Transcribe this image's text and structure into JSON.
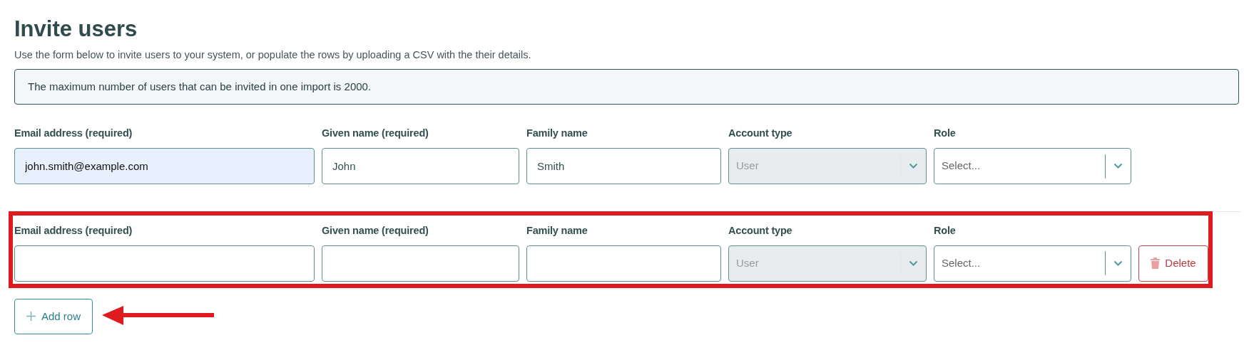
{
  "title": "Invite users",
  "intro": "Use the form below to invite users to your system, or populate the rows by uploading a CSV with the their details.",
  "notice": "The maximum number of users that can be invited in one import is 2000.",
  "rows": [
    {
      "annotated": false,
      "fields": [
        {
          "kind": "text",
          "label": "Email address (required)",
          "value": "john.smith@example.com",
          "autofilled": true
        },
        {
          "kind": "text",
          "label": "Given name (required)",
          "value": "John",
          "autofilled": false
        },
        {
          "kind": "text",
          "label": "Family name",
          "value": "Smith",
          "autofilled": false
        },
        {
          "kind": "select",
          "label": "Account type",
          "value": "User",
          "disabled": true
        },
        {
          "kind": "select",
          "label": "Role",
          "placeholder": "Select...",
          "disabled": false
        }
      ]
    },
    {
      "annotated": true,
      "delete_label": "Delete",
      "fields": [
        {
          "kind": "text",
          "label": "Email address (required)",
          "autofilled": false
        },
        {
          "kind": "text",
          "label": "Given name (required)",
          "autofilled": false
        },
        {
          "kind": "text",
          "label": "Family name",
          "autofilled": false
        },
        {
          "kind": "select",
          "label": "Account type",
          "value": "User",
          "disabled": true
        },
        {
          "kind": "select",
          "label": "Role",
          "placeholder": "Select...",
          "disabled": false
        }
      ]
    }
  ],
  "add_row": {
    "label": "Add row",
    "annotated": true
  }
}
